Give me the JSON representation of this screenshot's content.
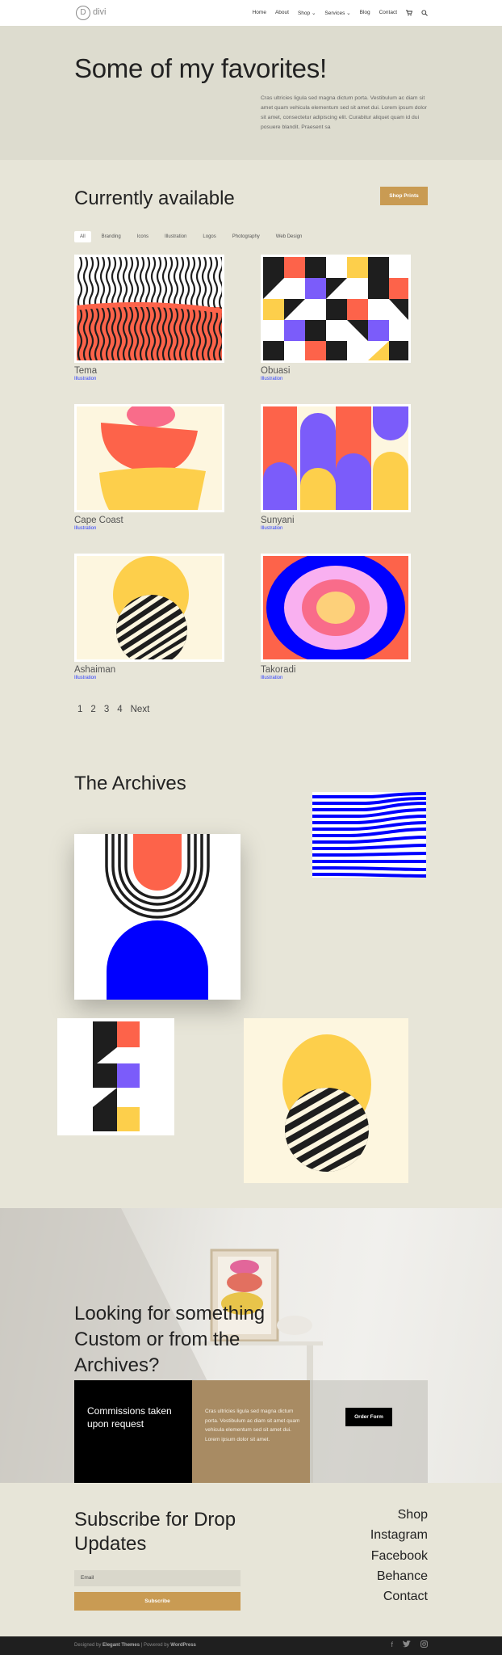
{
  "header": {
    "logo_letter": "D",
    "logo_text": "divi",
    "nav": [
      "Home",
      "About",
      "Shop ⌄",
      "Services ⌄",
      "Blog",
      "Contact"
    ],
    "cart_icon": "cart-icon",
    "search_icon": "search-icon"
  },
  "hero": {
    "title": "Some of my favorites!",
    "text": "Cras ultricies ligula sed magna dictum porta. Vestibulum ac diam sit amet quam vehicula elementum sed sit amet dui. Lorem ipsum dolor sit amet, consectetur adipiscing elit. Curabitur aliquet quam id dui posuere blandit. Praesent sa"
  },
  "shop": {
    "title": "Currently available",
    "button": "Shop Prints",
    "filters": [
      "All",
      "Branding",
      "Icons",
      "Illustration",
      "Logos",
      "Photography",
      "Web Design"
    ],
    "active_filter": "All",
    "items": [
      {
        "name": "Tema",
        "category": "Illustration"
      },
      {
        "name": "Obuasi",
        "category": "Illustration"
      },
      {
        "name": "Cape Coast",
        "category": "Illustration"
      },
      {
        "name": "Sunyani",
        "category": "Illustration"
      },
      {
        "name": "Ashaiman",
        "category": "Illustration"
      },
      {
        "name": "Takoradi",
        "category": "Illustration"
      }
    ],
    "pagination": [
      "1",
      "2",
      "3",
      "4",
      "Next"
    ]
  },
  "archives": {
    "title": "The Archives"
  },
  "commission": {
    "title": "Looking for something Custom or from the Archives?",
    "box_title": "Commissions taken upon request",
    "box_text": "Cras ultricies ligula sed magna dictum porta. Vestibulum ac diam sit amet quam vehicula elementum sed sit amet dui. Lorem ipsum dolor sit amet.",
    "button": "Order Form"
  },
  "subscribe": {
    "title": "Subscribe for Drop Updates",
    "email_placeholder": "Email",
    "button": "Subscribe"
  },
  "footer": {
    "links": [
      "Shop",
      "Instagram",
      "Facebook",
      "Behance",
      "Contact"
    ],
    "credit_prefix": "Designed by ",
    "credit_brand": "Elegant Themes",
    "credit_mid": " | Powered by ",
    "credit_wp": "WordPress",
    "social": [
      "facebook-icon",
      "twitter-icon",
      "instagram-icon"
    ]
  },
  "colors": {
    "background": "#e7e5d8",
    "hero_bg": "#dddccf",
    "gold": "#c99b53",
    "tan": "#a88b63",
    "coral": "#fd634a",
    "blue": "#0000ff",
    "yellow": "#fdcf4b",
    "purple": "#7b5cfa",
    "pink": "#f96c8a",
    "cream": "#fdf6df"
  }
}
